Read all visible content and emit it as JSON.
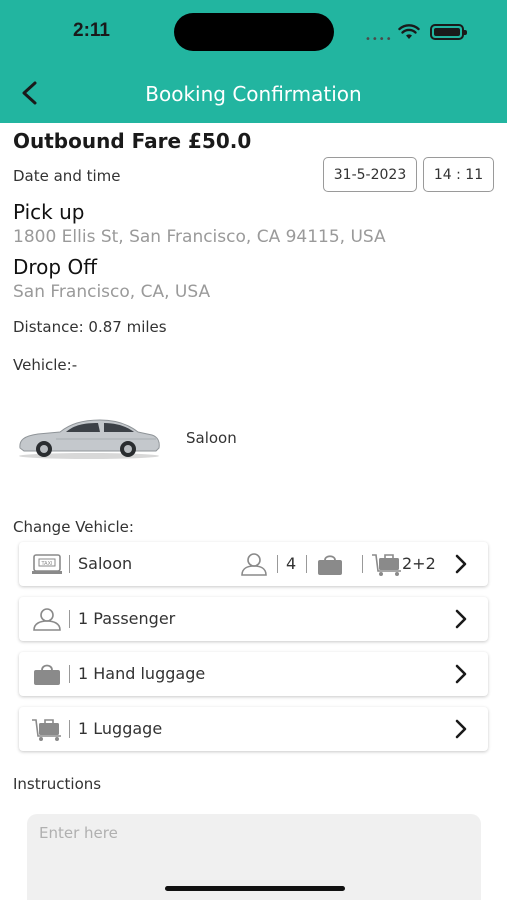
{
  "status_bar": {
    "time": "2:11"
  },
  "header": {
    "title": "Booking Confirmation"
  },
  "booking": {
    "fare": "Outbound Fare £50.0",
    "date_time_label": "Date and time",
    "date": "31-5-2023",
    "time": "14 : 11",
    "pickup_label": "Pick up",
    "pickup_address": "1800 Ellis St, San Francisco, CA 94115, USA",
    "dropoff_label": "Drop Off",
    "dropoff_address": "San Francisco, CA, USA",
    "distance": "Distance: 0.87 miles",
    "vehicle_label": "Vehicle:-",
    "vehicle_name": "Saloon"
  },
  "change_vehicle": {
    "label": "Change Vehicle:",
    "vehicle_row": {
      "name": "Saloon",
      "passengers": "4",
      "luggage": "2+2"
    },
    "passengers_row": "1 Passenger",
    "hand_luggage_row": "1 Hand luggage",
    "luggage_row": "1 Luggage"
  },
  "instructions": {
    "label": "Instructions",
    "placeholder": "Enter here"
  },
  "colors": {
    "header": "#22b5a0",
    "muted_text": "#9a9a9a",
    "icon_gray": "#8a8a8a"
  }
}
